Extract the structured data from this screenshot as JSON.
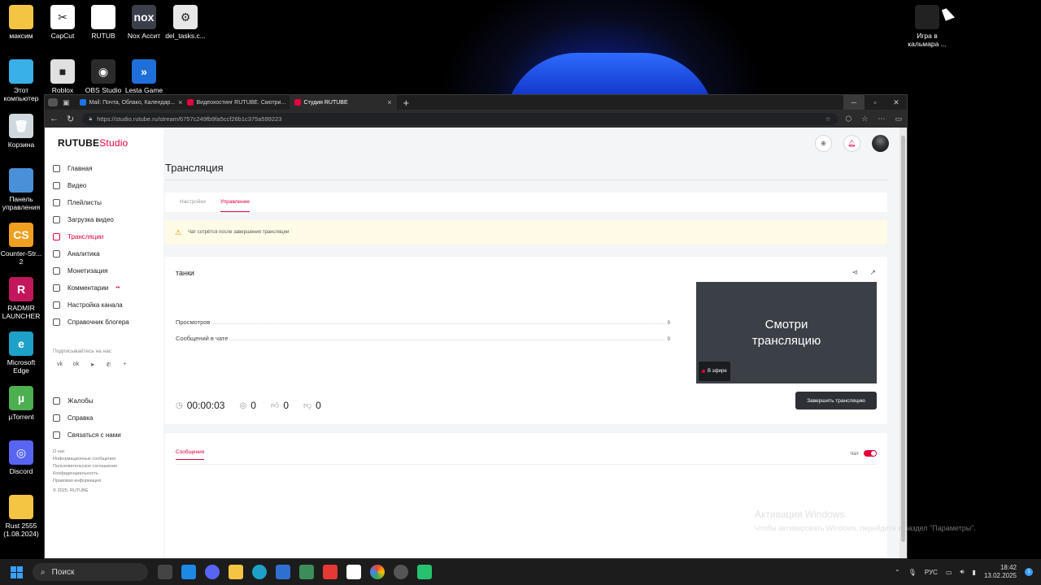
{
  "desktop": {
    "icons": [
      {
        "label": "максим",
        "name": "folder-maksim",
        "color": "#f4c542",
        "glyph": ""
      },
      {
        "label": "CapCut",
        "name": "capcut",
        "color": "#ffffff",
        "glyph": "✂"
      },
      {
        "label": "RUTUB",
        "name": "rutub-file",
        "color": "#ffffff",
        "glyph": ""
      },
      {
        "label": "Nox Ассит",
        "name": "nox",
        "color": "#3a3f4b",
        "glyph": "nox"
      },
      {
        "label": "del_tasks.c...",
        "name": "del-tasks",
        "color": "#e8e8e8",
        "glyph": "⚙"
      },
      {
        "label": "Этот компьютер",
        "name": "this-pc",
        "color": "#3ab0e8",
        "glyph": ""
      },
      {
        "label": "Roblox Player",
        "name": "roblox",
        "color": "#e0e0e0",
        "glyph": "■"
      },
      {
        "label": "OBS Studio",
        "name": "obs",
        "color": "#2b2b2b",
        "glyph": "◉"
      },
      {
        "label": "Lesta Game",
        "name": "lesta",
        "color": "#1e6fd9",
        "glyph": "»"
      },
      {
        "label": "Корзина",
        "name": "recycle-bin",
        "color": "#cfd8dc",
        "glyph": "🗑"
      },
      {
        "label": "Панель управления",
        "name": "control-panel",
        "color": "#4a90d9",
        "glyph": ""
      },
      {
        "label": "Counter-Str... 2",
        "name": "cs2",
        "color": "#f0a020",
        "glyph": "CS"
      },
      {
        "label": "RADMIR LAUNCHER",
        "name": "radmir",
        "color": "#c2185b",
        "glyph": "R"
      },
      {
        "label": "Microsoft Edge",
        "name": "edge",
        "color": "#1da1c9",
        "glyph": "e"
      },
      {
        "label": "µTorrent",
        "name": "utorrent",
        "color": "#4caf50",
        "glyph": "µ"
      },
      {
        "label": "Discord",
        "name": "discord",
        "color": "#5865f2",
        "glyph": "◎"
      },
      {
        "label": "Rust 2555 (1.08.2024)",
        "name": "rust-folder",
        "color": "#f4c542",
        "glyph": ""
      }
    ],
    "squid_game": {
      "label": "Игра в кальмара ..."
    }
  },
  "browser": {
    "tabs": [
      {
        "label": "Mail: Почта, Облако, Календар...",
        "color": "#1a73e8"
      },
      {
        "label": "Видеохостинг RUTUBE. Смотри...",
        "color": "#e4003a"
      },
      {
        "label": "Студия RUTUBE",
        "color": "#e4003a"
      }
    ],
    "url": "https://studio.rutube.ru/stream/6757c249fb9fa5ccf26b1c375a599223",
    "window_controls": {
      "minimize": "─",
      "maximize": "▫",
      "close": "✕"
    }
  },
  "studio": {
    "logo": {
      "brand": "RUTUBE",
      "suffix": "Studio"
    },
    "menu": [
      {
        "label": "Главная",
        "active": false
      },
      {
        "label": "Видео",
        "active": false
      },
      {
        "label": "Плейлисты",
        "active": false
      },
      {
        "label": "Загрузка видео",
        "active": false
      },
      {
        "label": "Трансляции",
        "active": true
      },
      {
        "label": "Аналитика",
        "active": false
      },
      {
        "label": "Монетизация",
        "active": false
      },
      {
        "label": "Комментарии",
        "active": false,
        "badge": "••"
      },
      {
        "label": "Настройка канала",
        "active": false
      },
      {
        "label": "Справочник блогера",
        "active": false
      }
    ],
    "subscribe_label": "Подписывайтесь на нас",
    "socials": [
      "vk",
      "ok",
      "tg",
      "vb",
      "+"
    ],
    "bottom_menu": [
      {
        "label": "Жалобы"
      },
      {
        "label": "Справка"
      },
      {
        "label": "Связаться с нами"
      }
    ],
    "footer": {
      "about": "О нас",
      "info": "Информационные сообщения",
      "agreement": "Пользовательское соглашение",
      "privacy": "Конфиденциальность",
      "legal": "Правовая информация",
      "copyright": "© 2025, RUTUBE"
    },
    "page_title": "Трансляция",
    "tabs": [
      {
        "label": "Настройки",
        "active": false
      },
      {
        "label": "Управление",
        "active": true
      }
    ],
    "alert": "Чат сотрётся после завершения трансляции",
    "stream": {
      "name": "танки",
      "views_label": "Просмотров",
      "views_value": "0",
      "chat_label": "Сообщений в чате",
      "chat_value": "0",
      "duration": "00:00:03",
      "viewers": "0",
      "likes": "0",
      "dislikes": "0",
      "preview_text": "Смотри трансляцию",
      "live_label": "В эфире",
      "end_button": "Завершить трансляцию"
    },
    "messages": {
      "tab": "Сообщения",
      "chat_toggle": "Чат",
      "chat_enabled": true
    }
  },
  "activation": {
    "title": "Активация Windows",
    "subtitle": "Чтобы активировать Windows, перейдите в раздел \"Параметры\"."
  },
  "taskbar": {
    "search": "Поиск",
    "lang": "РУС",
    "time": "18:42",
    "date": "13.02.2025",
    "notifications": "1"
  }
}
